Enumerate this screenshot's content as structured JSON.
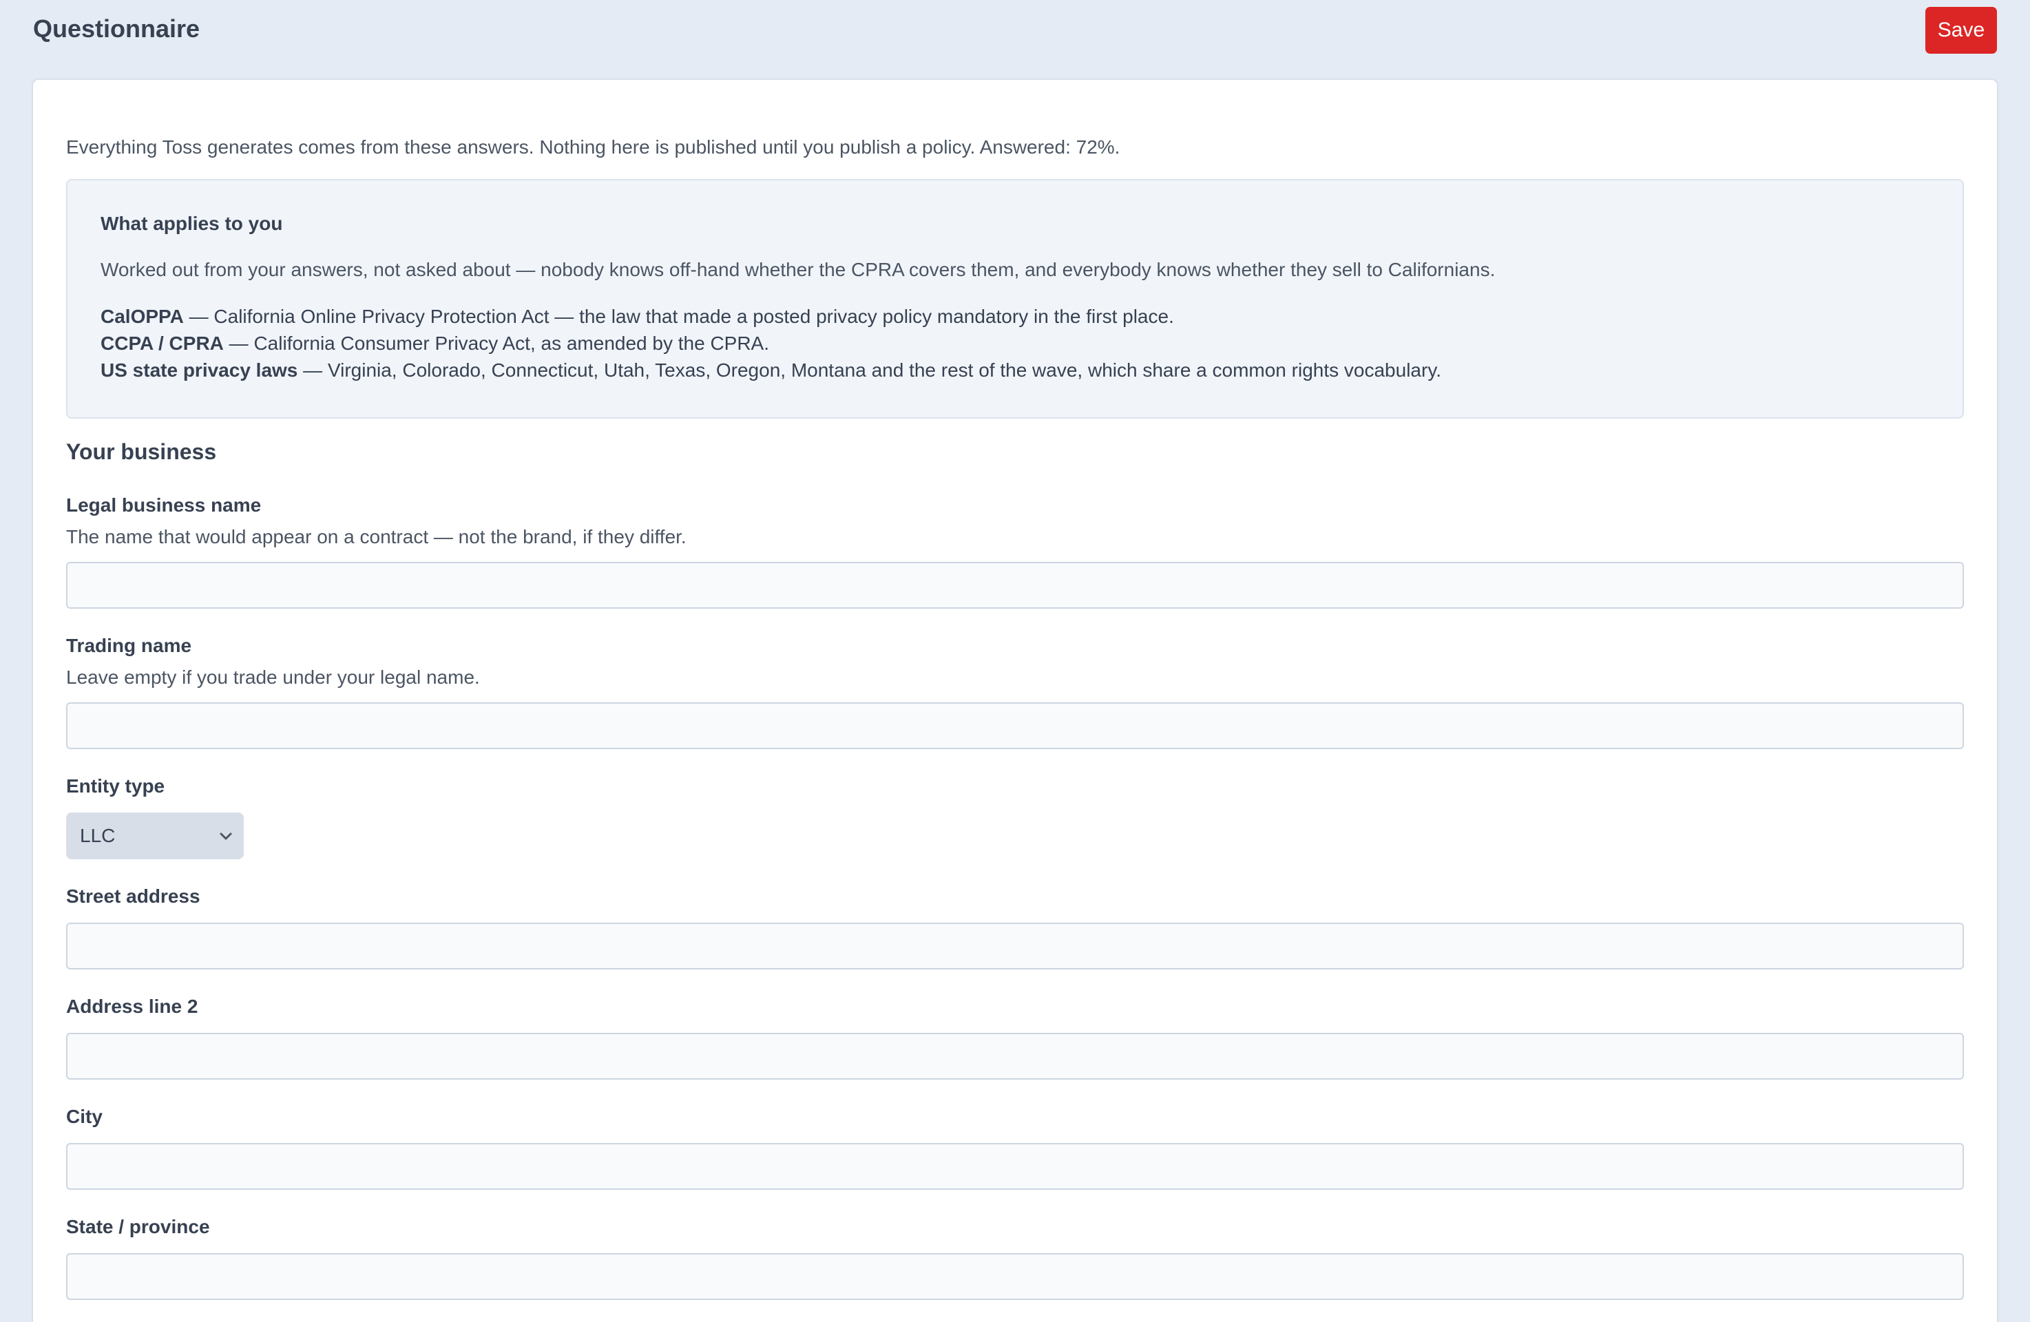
{
  "header": {
    "title": "Questionnaire",
    "save_label": "Save"
  },
  "intro": "Everything Toss generates comes from these answers. Nothing here is published until you publish a policy. Answered: 72%.",
  "applies": {
    "title": "What applies to you",
    "description": "Worked out from your answers, not asked about — nobody knows off-hand whether the CPRA covers them, and everybody knows whether they sell to Californians.",
    "laws": [
      {
        "name": "CalOPPA",
        "text": " — California Online Privacy Protection Act — the law that made a posted privacy policy mandatory in the first place."
      },
      {
        "name": "CCPA / CPRA",
        "text": " — California Consumer Privacy Act, as amended by the CPRA."
      },
      {
        "name": "US state privacy laws",
        "text": " — Virginia, Colorado, Connecticut, Utah, Texas, Oregon, Montana and the rest of the wave, which share a common rights vocabulary."
      }
    ]
  },
  "section": {
    "title": "Your business"
  },
  "fields": {
    "legal_name": {
      "label": "Legal business name",
      "help": "The name that would appear on a contract — not the brand, if they differ.",
      "value": ""
    },
    "trading_name": {
      "label": "Trading name",
      "help": "Leave empty if you trade under your legal name.",
      "value": ""
    },
    "entity_type": {
      "label": "Entity type",
      "selected": "LLC"
    },
    "street": {
      "label": "Street address",
      "value": ""
    },
    "address2": {
      "label": "Address line 2",
      "value": ""
    },
    "city": {
      "label": "City",
      "value": ""
    },
    "state": {
      "label": "State / province",
      "value": ""
    }
  },
  "colors": {
    "page_bg": "#e4ebf4",
    "save_button": "#dc2626",
    "card_bg": "#ffffff",
    "info_box_bg": "#f1f5fa"
  },
  "icons": {
    "select_chevron": "chevron-down-icon"
  }
}
